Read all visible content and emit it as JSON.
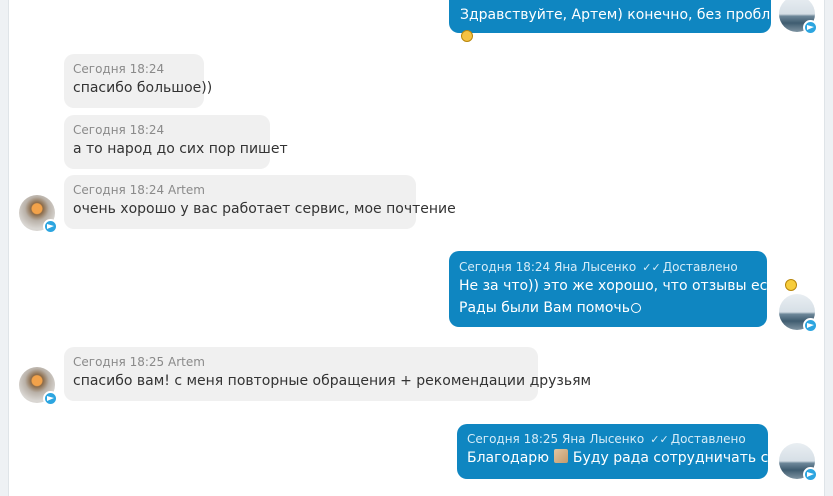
{
  "colors": {
    "incoming_bubble": "#f0f0f0",
    "outgoing_bubble": "#0f86c1",
    "telegram": "#2ca5e0"
  },
  "messages": [
    {
      "direction": "out",
      "text": "Здравствуйте, Артем) конечно, без проблем",
      "emoji": "ok-hand-icon"
    },
    {
      "direction": "in",
      "meta": "Сегодня 18:24",
      "text": "спасибо большое))"
    },
    {
      "direction": "in",
      "meta": "Сегодня 18:24",
      "text": "а то народ до сих пор пишет"
    },
    {
      "direction": "in",
      "meta": "Сегодня 18:24 Artem",
      "text": "очень хорошо у вас работает сервис, мое почтение"
    },
    {
      "direction": "out",
      "meta": "Сегодня 18:24 Яна Лысенко",
      "check": "✓✓",
      "status": "Доставлено",
      "line1": "Не за что)) это же хорошо, что отзывы есть",
      "line2": "Рады были Вам помочь"
    },
    {
      "direction": "in",
      "meta": "Сегодня 18:25 Artem",
      "text": "спасибо вам! с меня повторные обращения + рекомендации друзьям"
    },
    {
      "direction": "out",
      "meta": "Сегодня 18:25 Яна Лысенко",
      "check": "✓✓",
      "status": "Доставлено",
      "text_before": "Благодарю",
      "text_after": "Буду рада сотрудничать снова)"
    }
  ]
}
